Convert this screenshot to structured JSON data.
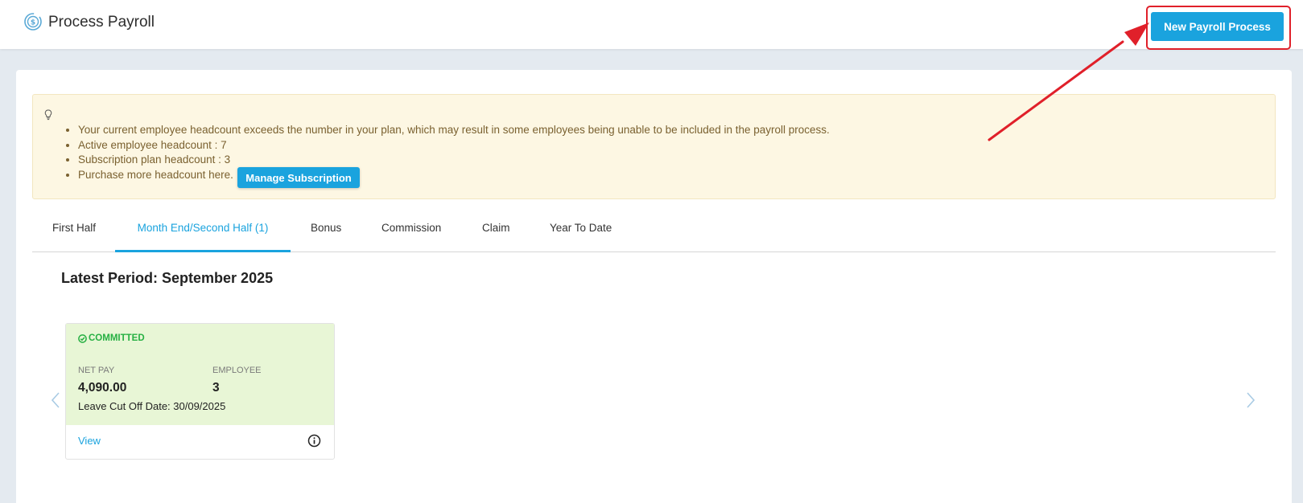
{
  "header": {
    "logo_icon": "payroll-coin-cycle-icon",
    "title": "Process Payroll",
    "new_payroll_button": "New Payroll Process"
  },
  "annotation": {
    "arrow_color": "#e0202a"
  },
  "alert": {
    "icon": "lightbulb-icon",
    "messages": [
      "Your current employee headcount exceeds the number in your plan, which may result in some employees being unable to be included in the payroll process.",
      "Active employee headcount : 7",
      "Subscription plan headcount : 3",
      "Purchase more headcount here."
    ],
    "manage_button": "Manage Subscription"
  },
  "tabs": [
    {
      "label": "First Half",
      "active": false
    },
    {
      "label": "Month End/Second Half (1)",
      "active": true
    },
    {
      "label": "Bonus",
      "active": false
    },
    {
      "label": "Commission",
      "active": false
    },
    {
      "label": "Claim",
      "active": false
    },
    {
      "label": "Year To Date",
      "active": false
    }
  ],
  "period": {
    "title": "Latest Period: September 2025"
  },
  "payroll_card": {
    "status": "COMMITTED",
    "net_pay_label": "NET PAY",
    "net_pay_value": "4,090.00",
    "employee_label": "EMPLOYEE",
    "employee_value": "3",
    "cutoff": "Leave Cut Off Date: 30/09/2025",
    "view_link": "View",
    "info_icon": "info-circle-icon"
  },
  "carousel": {
    "prev_icon": "chevron-left-icon",
    "next_icon": "chevron-right-icon"
  },
  "colors": {
    "primary": "#1aa3de",
    "committed": "#27b043",
    "alert_bg": "#fdf7e3",
    "card_top_bg": "#e8f6d6"
  }
}
